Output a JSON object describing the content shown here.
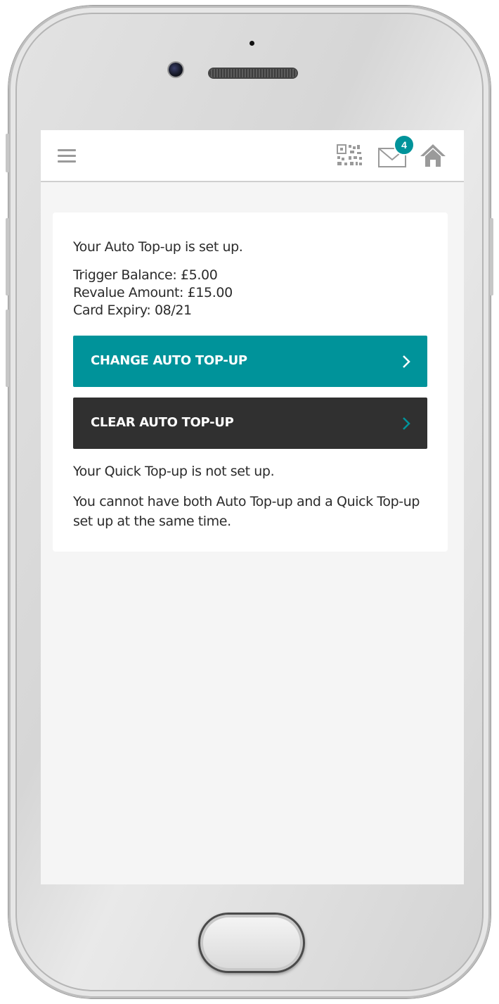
{
  "header": {
    "notification_count": "4",
    "icons": [
      "menu-icon",
      "qr-code-icon",
      "mail-icon",
      "home-icon"
    ],
    "accent_color": "#00939a"
  },
  "card": {
    "auto_topup_status": "Your Auto Top-up is set up.",
    "trigger_balance": "Trigger Balance: £5.00",
    "revalue_amount": "Revalue Amount: £15.00",
    "card_expiry": "Card Expiry: 08/21",
    "change_button": {
      "label": "CHANGE AUTO TOP-UP",
      "color": "#00939a"
    },
    "clear_button": {
      "label": "CLEAR AUTO TOP-UP",
      "color": "#303030"
    },
    "quick_topup_status": "Your Quick Top-up is not set up.",
    "note": "You cannot have both Auto Top-up and a Quick Top-up set up at the same time."
  }
}
